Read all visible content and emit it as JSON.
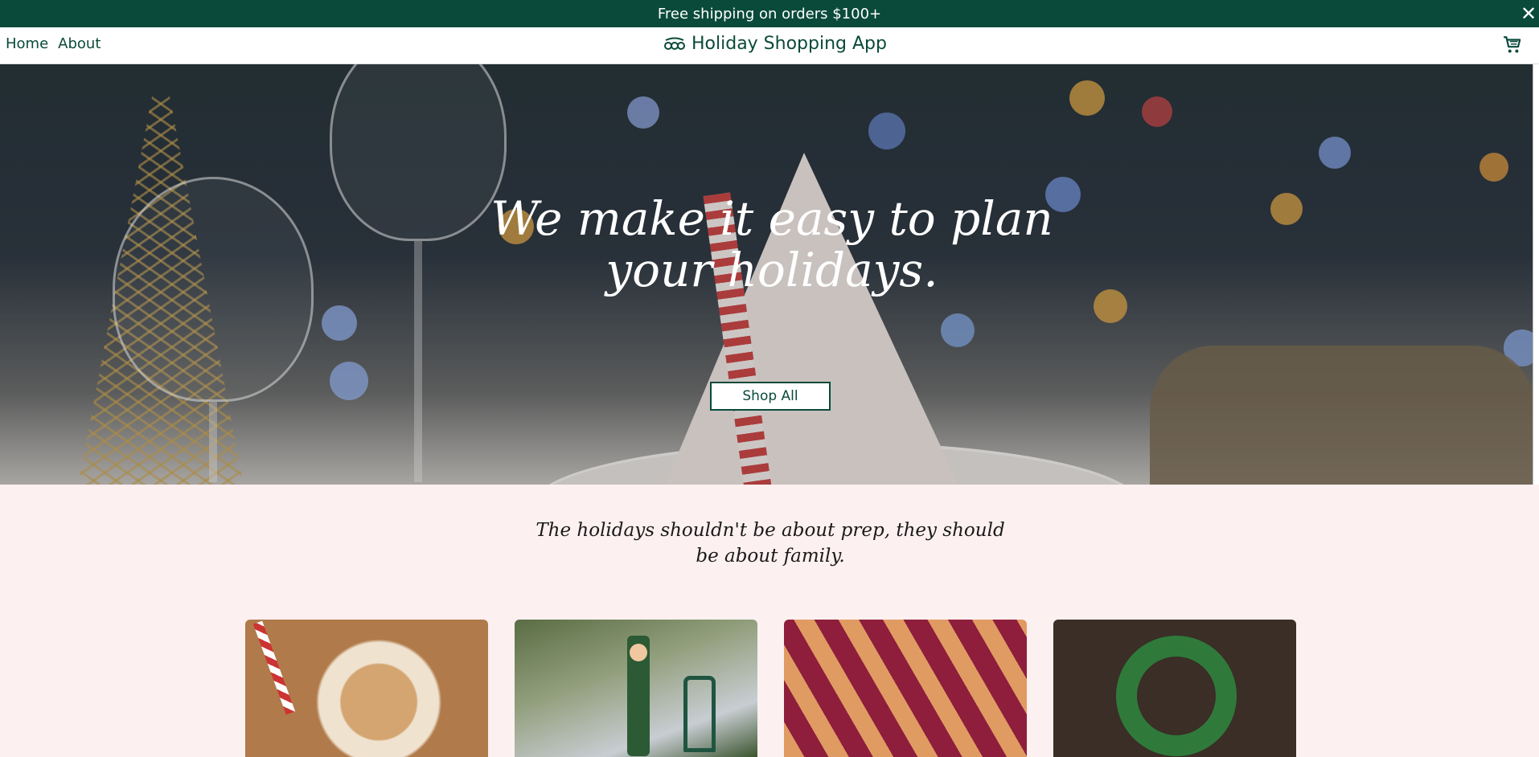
{
  "promo": {
    "text": "Free shipping on orders $100+",
    "close_glyph": "✕"
  },
  "nav": {
    "links": [
      {
        "label": "Home"
      },
      {
        "label": "About"
      }
    ],
    "brand": {
      "name": "Holiday Shopping App",
      "icon": "sleigh-bells-icon"
    },
    "cart_icon": "shopping-cart-icon"
  },
  "hero": {
    "heading": "We make it easy to plan your holidays.",
    "cta_label": "Shop All",
    "background": "holiday-table-photo"
  },
  "tagline": "The holidays shouldn't be about prep, they should be about family.",
  "categories": [
    {
      "image": "gingerbread-cookies-photo"
    },
    {
      "image": "nutcracker-lantern-photo"
    },
    {
      "image": "lattice-pie-photo"
    },
    {
      "image": "wreath-door-photo"
    }
  ],
  "colors": {
    "brand_green": "#0a4a3a",
    "page_bg": "#fdf0f0",
    "white": "#ffffff"
  }
}
